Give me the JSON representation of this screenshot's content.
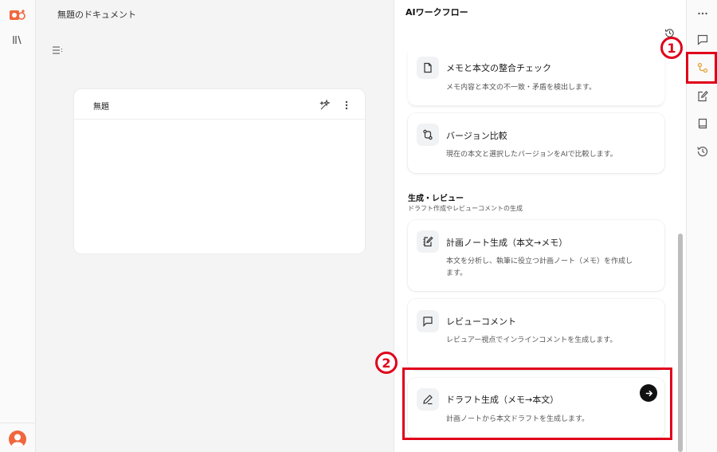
{
  "document": {
    "title": "無題のドキュメント",
    "editor_name": "無題"
  },
  "panel": {
    "title": "AIワークフロー",
    "cards_top": [
      {
        "title": "メモと本文の整合チェック",
        "desc": "メモ内容と本文の不一致・矛盾を検出します。",
        "icon": "file-icon"
      },
      {
        "title": "バージョン比較",
        "desc": "現在の本文と選択したバージョンをAIで比較します。",
        "icon": "git-compare-icon"
      }
    ],
    "section": {
      "heading": "生成・レビュー",
      "sub": "ドラフト作成やレビューコメントの生成"
    },
    "cards_gen": [
      {
        "title": "計画ノート生成（本文→メモ）",
        "desc": "本文を分析し、執筆に役立つ計画ノート（メモ）を作成します。",
        "icon": "notebook-pen-icon"
      },
      {
        "title": "レビューコメント",
        "desc": "レビュアー視点でインラインコメントを生成します。",
        "icon": "message-square-icon"
      },
      {
        "title": "ドラフト生成（メモ→本文）",
        "desc": "計画ノートから本文ドラフトを生成します。",
        "icon": "pencil-icon"
      }
    ]
  },
  "annotations": {
    "badge1": "1",
    "badge2": "2",
    "color": "#e0001a"
  },
  "colors": {
    "accent": "#e8a23a",
    "avatar": "#f0673d"
  }
}
